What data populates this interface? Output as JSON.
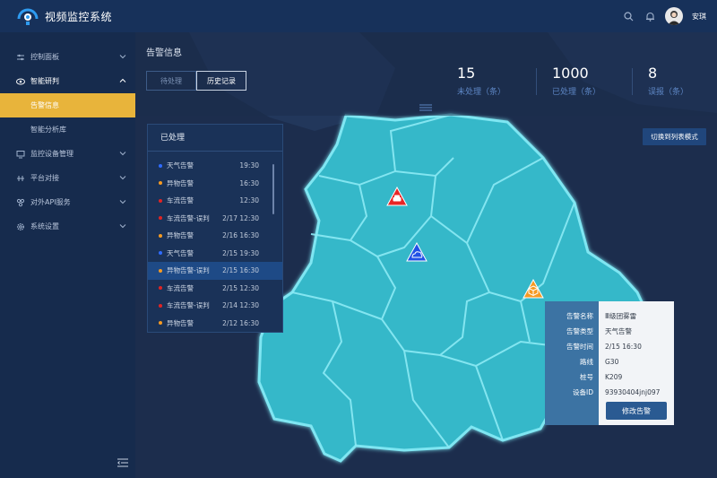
{
  "header": {
    "app_title": "视频监控系统",
    "username": "安琪",
    "icons": [
      "search-icon",
      "bell-icon"
    ]
  },
  "sidebar": {
    "items": [
      {
        "label": "控制面板",
        "icon": "sliders-icon"
      },
      {
        "label": "智能研判",
        "icon": "eye-icon",
        "children": [
          {
            "label": "告警信息",
            "active": true
          },
          {
            "label": "智能分析库",
            "active": false
          }
        ]
      },
      {
        "label": "监控设备管理",
        "icon": "monitor-icon"
      },
      {
        "label": "平台对接",
        "icon": "link-icon"
      },
      {
        "label": "对外API服务",
        "icon": "api-icon"
      },
      {
        "label": "系统设置",
        "icon": "gear-icon"
      }
    ]
  },
  "page": {
    "title": "告警信息",
    "tabs": [
      {
        "label": "待处理",
        "active": false
      },
      {
        "label": "历史记录",
        "active": true
      }
    ],
    "stats": [
      {
        "value": "15",
        "label": "未处理（条）"
      },
      {
        "value": "1000",
        "label": "已处理（条）"
      },
      {
        "value": "8",
        "label": "误报（条）"
      }
    ],
    "switch_label": "切换到列表模式"
  },
  "processed_list": {
    "title": "已处理",
    "rows": [
      {
        "name": "天气告警",
        "time": "19:30",
        "color": "#2f6bff"
      },
      {
        "name": "异物告警",
        "time": "16:30",
        "color": "#f59a23"
      },
      {
        "name": "车流告警",
        "time": "12:30",
        "color": "#e02424"
      },
      {
        "name": "车流告警-误判",
        "time": "2/17 12:30",
        "color": "#e02424"
      },
      {
        "name": "异物告警",
        "time": "2/16 16:30",
        "color": "#f59a23"
      },
      {
        "name": "天气告警",
        "time": "2/15 19:30",
        "color": "#2f6bff"
      },
      {
        "name": "异物告警-误判",
        "time": "2/15 16:30",
        "color": "#f59a23",
        "selected": true
      },
      {
        "name": "车流告警",
        "time": "2/15 12:30",
        "color": "#e02424"
      },
      {
        "name": "车流告警-误判",
        "time": "2/14 12:30",
        "color": "#e02424"
      },
      {
        "name": "异物告警",
        "time": "2/12 16:30",
        "color": "#f59a23"
      }
    ]
  },
  "detail": {
    "fields": [
      {
        "label": "告警名称",
        "value": "Ⅲ级团雾雷"
      },
      {
        "label": "告警类型",
        "value": "天气告警"
      },
      {
        "label": "告警时间",
        "value": "2/15 16:30"
      },
      {
        "label": "路线",
        "value": "G30"
      },
      {
        "label": "桩号",
        "value": "K209"
      },
      {
        "label": "设备ID",
        "value": "93930404jnj097"
      }
    ],
    "edit_label": "修改告警"
  },
  "colors": {
    "active": "#e8b43b",
    "map_fill": "#36b8c9",
    "map_border": "#7fe6f2"
  }
}
